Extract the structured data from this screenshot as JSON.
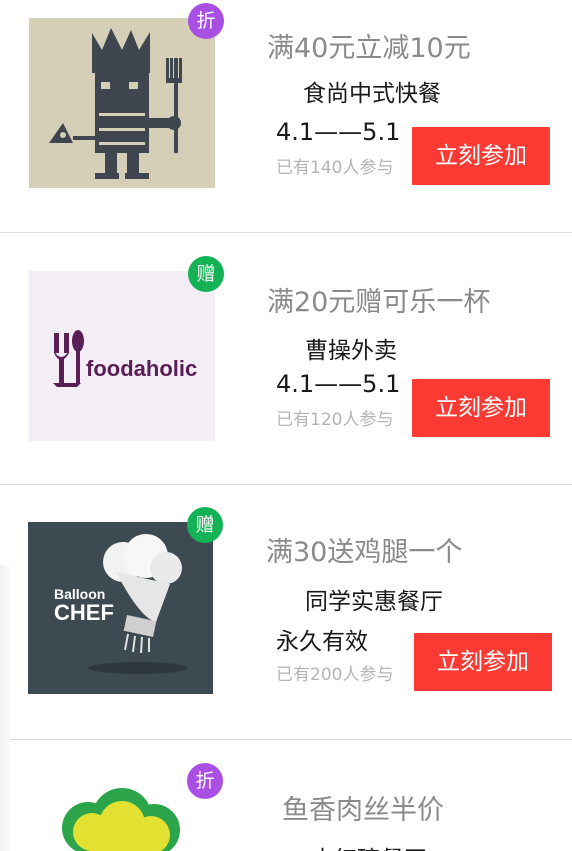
{
  "promotions": [
    {
      "badge": "折",
      "badge_type": "discount",
      "title": "满40元立减10元",
      "shop": "食尚中式快餐",
      "date": "4.1——5.1",
      "joined": "已有140人参与",
      "button": "立刻参加"
    },
    {
      "badge": "赠",
      "badge_type": "gift",
      "title": "满20元赠可乐一杯",
      "shop": "曹操外卖",
      "logo_text": "foodaholic",
      "date": "4.1——5.1",
      "joined": "已有120人参与",
      "button": "立刻参加"
    },
    {
      "badge": "赠",
      "badge_type": "gift",
      "title": "满30送鸡腿一个",
      "shop": "同学实惠餐厅",
      "logo_text_1": "Balloon",
      "logo_text_2": "CHEF",
      "date": "永久有效",
      "joined": "已有200人参与",
      "button": "立刻参加"
    },
    {
      "badge": "折",
      "badge_type": "discount",
      "title": "鱼香肉丝半价",
      "shop": "大红碗餐厅"
    }
  ],
  "colors": {
    "button": "#fa3a33",
    "badge_discount": "#a94fe3",
    "badge_gift": "#13b254",
    "title": "#8a8a8a"
  }
}
